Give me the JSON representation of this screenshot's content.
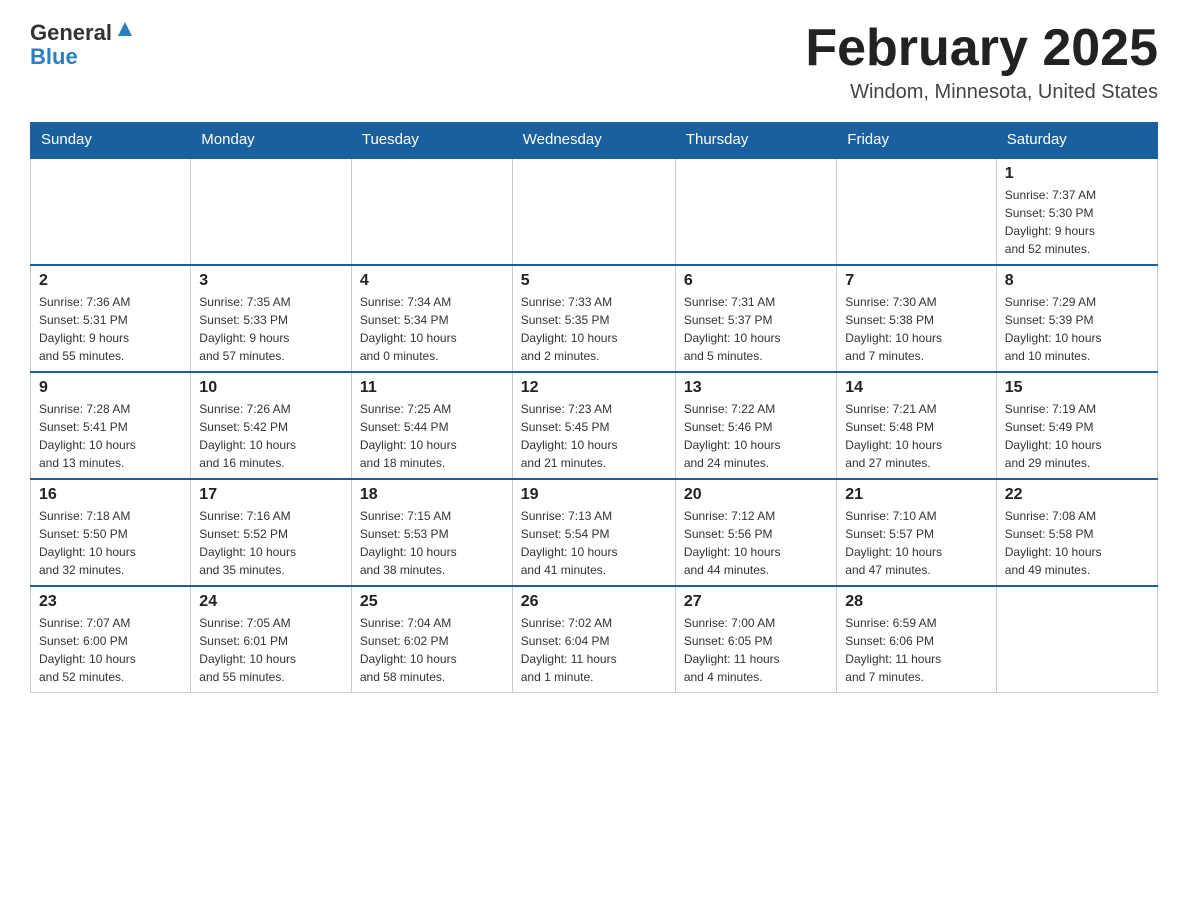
{
  "header": {
    "logo_general": "General",
    "logo_blue": "Blue",
    "month_title": "February 2025",
    "location": "Windom, Minnesota, United States"
  },
  "days_of_week": [
    "Sunday",
    "Monday",
    "Tuesday",
    "Wednesday",
    "Thursday",
    "Friday",
    "Saturday"
  ],
  "weeks": [
    [
      {
        "day": "",
        "info": ""
      },
      {
        "day": "",
        "info": ""
      },
      {
        "day": "",
        "info": ""
      },
      {
        "day": "",
        "info": ""
      },
      {
        "day": "",
        "info": ""
      },
      {
        "day": "",
        "info": ""
      },
      {
        "day": "1",
        "info": "Sunrise: 7:37 AM\nSunset: 5:30 PM\nDaylight: 9 hours\nand 52 minutes."
      }
    ],
    [
      {
        "day": "2",
        "info": "Sunrise: 7:36 AM\nSunset: 5:31 PM\nDaylight: 9 hours\nand 55 minutes."
      },
      {
        "day": "3",
        "info": "Sunrise: 7:35 AM\nSunset: 5:33 PM\nDaylight: 9 hours\nand 57 minutes."
      },
      {
        "day": "4",
        "info": "Sunrise: 7:34 AM\nSunset: 5:34 PM\nDaylight: 10 hours\nand 0 minutes."
      },
      {
        "day": "5",
        "info": "Sunrise: 7:33 AM\nSunset: 5:35 PM\nDaylight: 10 hours\nand 2 minutes."
      },
      {
        "day": "6",
        "info": "Sunrise: 7:31 AM\nSunset: 5:37 PM\nDaylight: 10 hours\nand 5 minutes."
      },
      {
        "day": "7",
        "info": "Sunrise: 7:30 AM\nSunset: 5:38 PM\nDaylight: 10 hours\nand 7 minutes."
      },
      {
        "day": "8",
        "info": "Sunrise: 7:29 AM\nSunset: 5:39 PM\nDaylight: 10 hours\nand 10 minutes."
      }
    ],
    [
      {
        "day": "9",
        "info": "Sunrise: 7:28 AM\nSunset: 5:41 PM\nDaylight: 10 hours\nand 13 minutes."
      },
      {
        "day": "10",
        "info": "Sunrise: 7:26 AM\nSunset: 5:42 PM\nDaylight: 10 hours\nand 16 minutes."
      },
      {
        "day": "11",
        "info": "Sunrise: 7:25 AM\nSunset: 5:44 PM\nDaylight: 10 hours\nand 18 minutes."
      },
      {
        "day": "12",
        "info": "Sunrise: 7:23 AM\nSunset: 5:45 PM\nDaylight: 10 hours\nand 21 minutes."
      },
      {
        "day": "13",
        "info": "Sunrise: 7:22 AM\nSunset: 5:46 PM\nDaylight: 10 hours\nand 24 minutes."
      },
      {
        "day": "14",
        "info": "Sunrise: 7:21 AM\nSunset: 5:48 PM\nDaylight: 10 hours\nand 27 minutes."
      },
      {
        "day": "15",
        "info": "Sunrise: 7:19 AM\nSunset: 5:49 PM\nDaylight: 10 hours\nand 29 minutes."
      }
    ],
    [
      {
        "day": "16",
        "info": "Sunrise: 7:18 AM\nSunset: 5:50 PM\nDaylight: 10 hours\nand 32 minutes."
      },
      {
        "day": "17",
        "info": "Sunrise: 7:16 AM\nSunset: 5:52 PM\nDaylight: 10 hours\nand 35 minutes."
      },
      {
        "day": "18",
        "info": "Sunrise: 7:15 AM\nSunset: 5:53 PM\nDaylight: 10 hours\nand 38 minutes."
      },
      {
        "day": "19",
        "info": "Sunrise: 7:13 AM\nSunset: 5:54 PM\nDaylight: 10 hours\nand 41 minutes."
      },
      {
        "day": "20",
        "info": "Sunrise: 7:12 AM\nSunset: 5:56 PM\nDaylight: 10 hours\nand 44 minutes."
      },
      {
        "day": "21",
        "info": "Sunrise: 7:10 AM\nSunset: 5:57 PM\nDaylight: 10 hours\nand 47 minutes."
      },
      {
        "day": "22",
        "info": "Sunrise: 7:08 AM\nSunset: 5:58 PM\nDaylight: 10 hours\nand 49 minutes."
      }
    ],
    [
      {
        "day": "23",
        "info": "Sunrise: 7:07 AM\nSunset: 6:00 PM\nDaylight: 10 hours\nand 52 minutes."
      },
      {
        "day": "24",
        "info": "Sunrise: 7:05 AM\nSunset: 6:01 PM\nDaylight: 10 hours\nand 55 minutes."
      },
      {
        "day": "25",
        "info": "Sunrise: 7:04 AM\nSunset: 6:02 PM\nDaylight: 10 hours\nand 58 minutes."
      },
      {
        "day": "26",
        "info": "Sunrise: 7:02 AM\nSunset: 6:04 PM\nDaylight: 11 hours\nand 1 minute."
      },
      {
        "day": "27",
        "info": "Sunrise: 7:00 AM\nSunset: 6:05 PM\nDaylight: 11 hours\nand 4 minutes."
      },
      {
        "day": "28",
        "info": "Sunrise: 6:59 AM\nSunset: 6:06 PM\nDaylight: 11 hours\nand 7 minutes."
      },
      {
        "day": "",
        "info": ""
      }
    ]
  ]
}
